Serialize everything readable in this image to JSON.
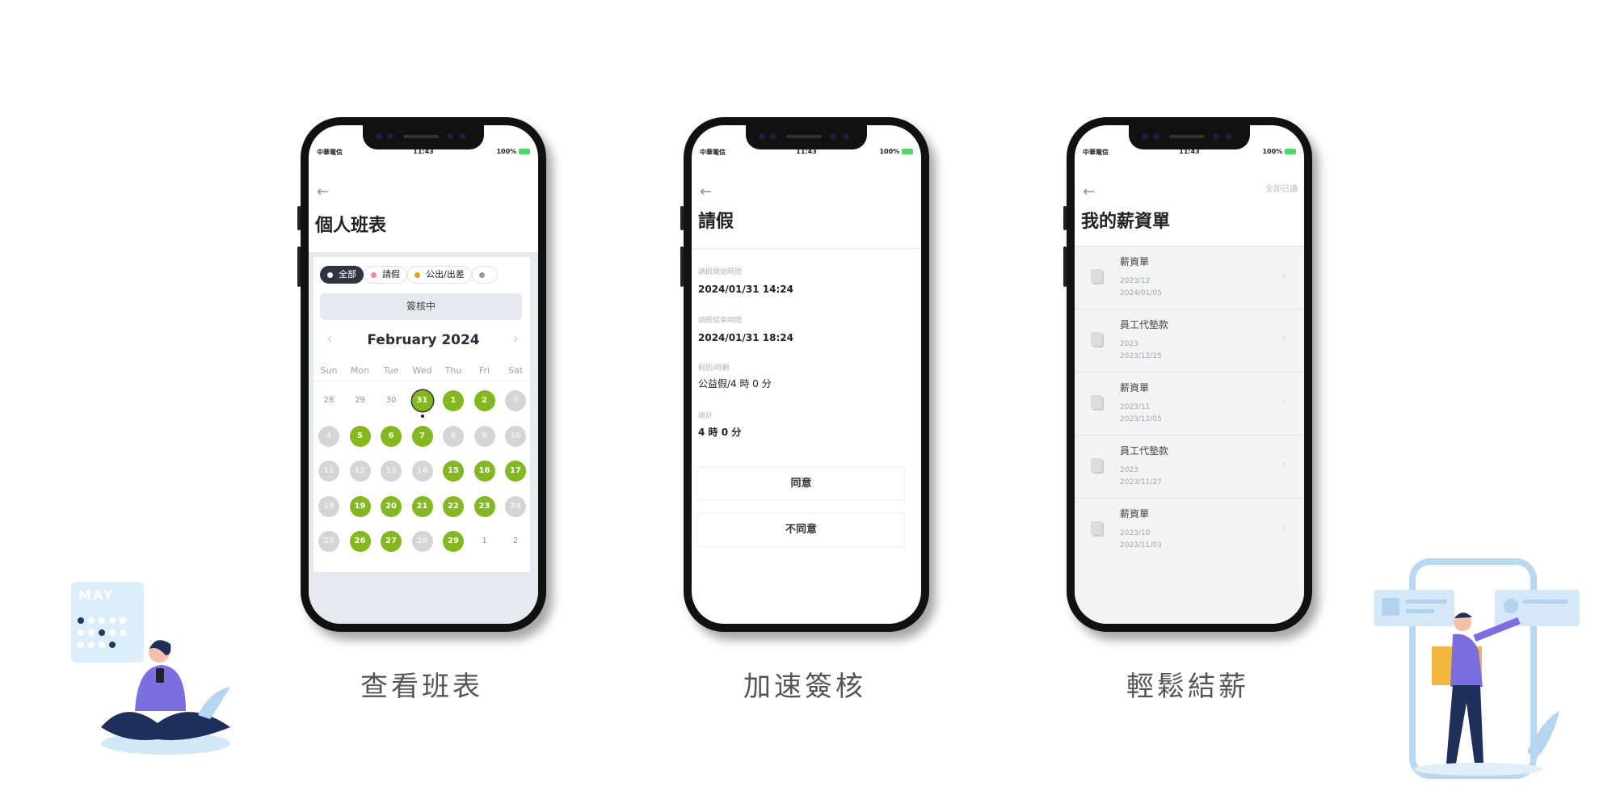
{
  "status_bar": {
    "carrier": "中華電信",
    "time": "11:43",
    "battery": "100%"
  },
  "phones": [
    {
      "title": "個人班表",
      "filters": [
        {
          "label": "全部",
          "color": "#ffffff",
          "active": true
        },
        {
          "label": "請假",
          "color": "#f28b95"
        },
        {
          "label": "公出/出差",
          "color": "#f39c12"
        },
        {
          "label": "",
          "color": "#999999"
        }
      ],
      "status_bar_label": "簽核中",
      "month": "February 2024",
      "weekdays": [
        "Sun",
        "Mon",
        "Tue",
        "Wed",
        "Thu",
        "Fri",
        "Sat"
      ],
      "days": [
        [
          "28",
          "plain"
        ],
        [
          "29",
          "plain"
        ],
        [
          "30",
          "plain"
        ],
        [
          "31",
          "green-selected"
        ],
        [
          "1",
          "green"
        ],
        [
          "2",
          "green"
        ],
        [
          "3",
          "gray"
        ],
        [
          "4",
          "gray"
        ],
        [
          "5",
          "green"
        ],
        [
          "6",
          "green"
        ],
        [
          "7",
          "green"
        ],
        [
          "8",
          "gray"
        ],
        [
          "9",
          "gray"
        ],
        [
          "10",
          "gray"
        ],
        [
          "11",
          "gray"
        ],
        [
          "12",
          "gray"
        ],
        [
          "13",
          "gray"
        ],
        [
          "14",
          "gray"
        ],
        [
          "15",
          "green"
        ],
        [
          "16",
          "green"
        ],
        [
          "17",
          "green"
        ],
        [
          "18",
          "gray"
        ],
        [
          "19",
          "green"
        ],
        [
          "20",
          "green"
        ],
        [
          "21",
          "green"
        ],
        [
          "22",
          "green"
        ],
        [
          "23",
          "green"
        ],
        [
          "24",
          "gray"
        ],
        [
          "25",
          "gray"
        ],
        [
          "26",
          "green"
        ],
        [
          "27",
          "green"
        ],
        [
          "28",
          "gray"
        ],
        [
          "29",
          "green"
        ],
        [
          "1",
          "plain"
        ],
        [
          "2",
          "plain"
        ]
      ],
      "colors": {
        "worked": "#84b81f",
        "off": "#d5d5d5"
      },
      "caption": "查看班表"
    },
    {
      "title": "請假",
      "fields": [
        {
          "label": "請假開始時間",
          "value": "2024/01/31 14:24"
        },
        {
          "label": "請假結束時間",
          "value": "2024/01/31 18:24"
        },
        {
          "label": "假別/時數",
          "value": "公益假/4 時 0 分"
        },
        {
          "label": "總計",
          "value": "4 時 0 分"
        }
      ],
      "approve": "同意",
      "reject": "不同意",
      "caption": "加速簽核"
    },
    {
      "title": "我的薪資單",
      "read_all": "全部已讀",
      "items": [
        {
          "title": "薪資單",
          "period": "2023/12",
          "date": "2024/01/05"
        },
        {
          "title": "員工代墊款",
          "period": "2023",
          "date": "2023/12/25"
        },
        {
          "title": "薪資單",
          "period": "2023/11",
          "date": "2023/12/05"
        },
        {
          "title": "員工代墊款",
          "period": "2023",
          "date": "2023/11/27"
        },
        {
          "title": "薪資單",
          "period": "2023/10",
          "date": "2023/11/03"
        }
      ],
      "caption": "輕鬆結薪"
    }
  ],
  "illustration_left": {
    "calendar_text": "MAY"
  }
}
